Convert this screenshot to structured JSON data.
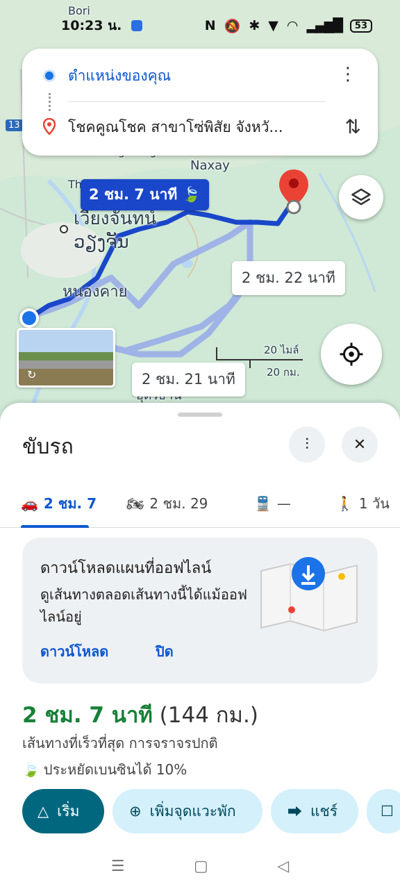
{
  "status_bar": {
    "time": "10:23 น.",
    "battery": "53"
  },
  "route_card": {
    "origin": "ตำแหน่งของคุณ",
    "destination": "โชคคูณโชค สาขาโซ่พิสัย จังหวั..."
  },
  "map": {
    "labels": {
      "naxay": "Naxay",
      "vientiane_th": "เวียงจันทน์",
      "vientiane_lo": "ວຽງຈັນ",
      "nong_khai": "หนองคาย",
      "thongmang": "Thongmang",
      "udon": "อุดรธานี",
      "bori": "Bori",
      "road_13": "13",
      "th": "Th"
    },
    "route_times": {
      "primary": "2 ชม. 7 นาที",
      "alt1": "2 ชม. 22 นาที",
      "alt2": "2 ชม. 21 นาที"
    },
    "scale": {
      "miles": "20 ไมล์",
      "km": "20 กม."
    }
  },
  "sheet": {
    "title": "ขับรถ",
    "modes": [
      {
        "name": "car",
        "label": "2 ชม. 7"
      },
      {
        "name": "motorcycle",
        "label": "2 ชม. 29"
      },
      {
        "name": "transit",
        "label": "—"
      },
      {
        "name": "walk",
        "label": "1 วัน"
      }
    ],
    "offline": {
      "heading": "ดาวน์โหลดแผนที่ออฟไลน์",
      "description": "ดูเส้นทางตลอดเส้นทางนี้ได้แม้ออฟไลน์อยู่",
      "download": "ดาวน์โหลด",
      "close": "ปิด"
    },
    "duration": "2 ชม. 7 นาที",
    "distance": "(144 กม.)",
    "route_desc": "เส้นทางที่เร็วที่สุด การจราจรปกติ",
    "eco": "ประหยัดเบนซินได้ 10%",
    "actions": {
      "start": "เริ่ม",
      "add_stop": "เพิ่มจุดแวะพัก",
      "share": "แชร์"
    }
  },
  "colors": {
    "primary_route": "#1a47c9",
    "alt_route": "#9fb3e6",
    "accent": "#00677f",
    "green": "#188038"
  }
}
